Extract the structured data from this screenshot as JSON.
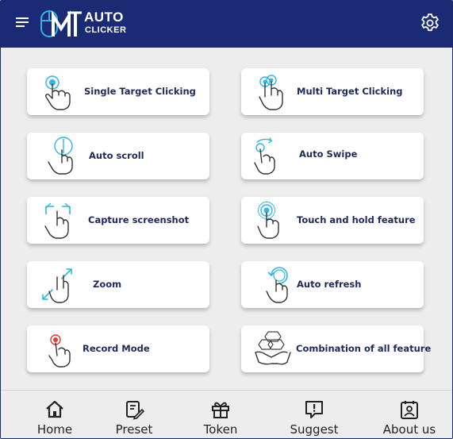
{
  "colors": {
    "header_bg": "#1a2a74",
    "accent": "#2fb6e8",
    "text_dark": "#1e2a5a",
    "page_bg": "#ededed"
  },
  "header": {
    "logo_auto": "AUTO",
    "logo_clicker": "CLICKER",
    "menu_icon": "hamburger-menu-icon",
    "settings_icon": "gear-icon"
  },
  "features": [
    {
      "label": "Single Target Clicking",
      "icon": "single-tap-icon"
    },
    {
      "label": "Multi Target Clicking",
      "icon": "multi-tap-icon"
    },
    {
      "label": "Auto scroll",
      "icon": "scroll-icon"
    },
    {
      "label": "Auto Swipe",
      "icon": "swipe-icon"
    },
    {
      "label": "Capture screenshot",
      "icon": "screenshot-icon"
    },
    {
      "label": "Touch and hold feature",
      "icon": "touch-hold-icon"
    },
    {
      "label": "Zoom",
      "icon": "zoom-icon"
    },
    {
      "label": "Auto refresh",
      "icon": "refresh-icon"
    },
    {
      "label": "Record Mode",
      "icon": "record-icon"
    },
    {
      "label": "Combination of all  feature",
      "icon": "combination-icon"
    }
  ],
  "nav": [
    {
      "label": "Home",
      "icon": "home-icon"
    },
    {
      "label": "Preset",
      "icon": "preset-icon"
    },
    {
      "label": "Token",
      "icon": "gift-icon"
    },
    {
      "label": "Suggest",
      "icon": "suggest-icon"
    },
    {
      "label": "About us",
      "icon": "about-icon"
    }
  ]
}
